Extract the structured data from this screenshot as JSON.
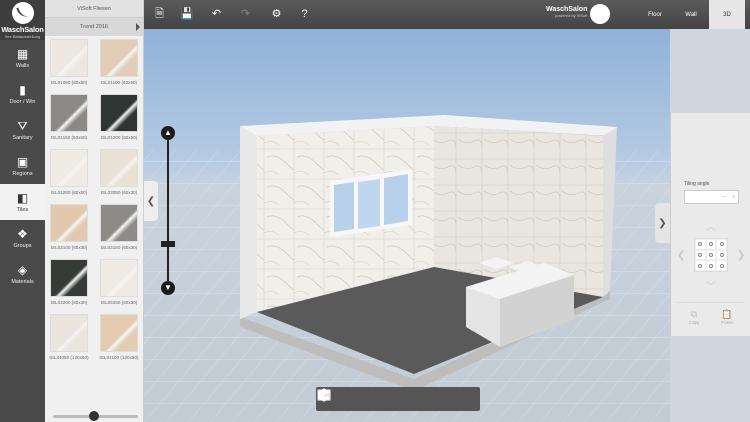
{
  "logo": {
    "brand": "WaschSalon",
    "sub": "Ihre Badausstellung"
  },
  "nav": [
    {
      "label": "Walls",
      "icon": "walls-icon",
      "glyph": "▦"
    },
    {
      "label": "Door / Win",
      "icon": "door-icon",
      "glyph": "▮"
    },
    {
      "label": "Sanitary",
      "icon": "sanitary-icon",
      "glyph": "⛛"
    },
    {
      "label": "Regions",
      "icon": "regions-icon",
      "glyph": "▣"
    },
    {
      "label": "Tiles",
      "icon": "tiles-icon",
      "glyph": "◧"
    },
    {
      "label": "Groups",
      "icon": "groups-icon",
      "glyph": "❖"
    },
    {
      "label": "Materials",
      "icon": "materials-icon",
      "glyph": "◈"
    }
  ],
  "catalog": {
    "header": "ViSoft Fliesen",
    "sub": "Trend 2016",
    "tiles": [
      {
        "label": "tSL01050 (60x60)",
        "color": "#ece8e1"
      },
      {
        "label": "tSL01100 (60x60)",
        "color": "#e3cdb6"
      },
      {
        "label": "tSL01150 (60x60)",
        "color": "#8b8985"
      },
      {
        "label": "tSL01200 (60x60)",
        "color": "#2f3532"
      },
      {
        "label": "tSL01250 (60x60)",
        "color": "#efebe5"
      },
      {
        "label": "tSL03050 (60x30)",
        "color": "#e8e1d6"
      },
      {
        "label": "tSL03100 (60x30)",
        "color": "#e2c9ae"
      },
      {
        "label": "tSL03150 (60x30)",
        "color": "#8d8b87"
      },
      {
        "label": "tSL03200 (60x30)",
        "color": "#363b38"
      },
      {
        "label": "tSL03250 (60x30)",
        "color": "#eeeae4"
      },
      {
        "label": "tSL34050 (120x60)",
        "color": "#e9e4dc"
      },
      {
        "label": "tSL34100 (120x60)",
        "color": "#e3ccb2"
      }
    ]
  },
  "toolbar": {
    "brand": "WaschSalon",
    "brand_sub": "powered by ViSoft",
    "tabs": [
      "Floor",
      "Wall",
      "3D"
    ],
    "active_tab": "3D"
  },
  "right_panel": {
    "tiling_label": "Tiling angle",
    "minus": "—",
    "plus": "+",
    "copy": "Copy",
    "paste": "Paste"
  }
}
